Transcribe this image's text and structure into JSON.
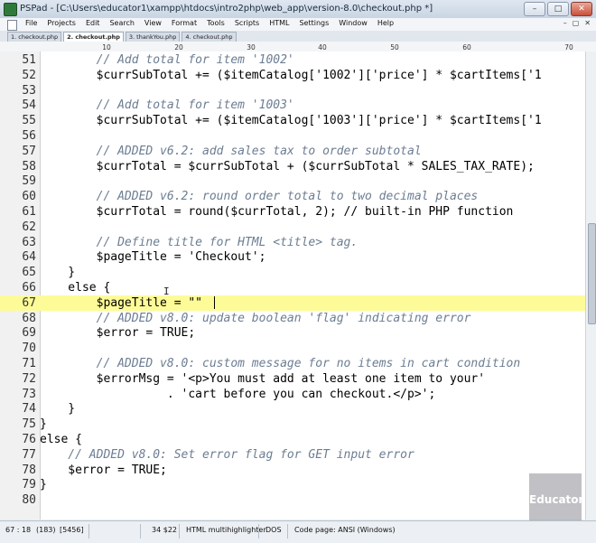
{
  "window": {
    "title": "PSPad - [C:\\Users\\educator1\\xampp\\htdocs\\intro2php\\web_app\\version-8.0\\checkout.php *]",
    "controls": {
      "minimize": "–",
      "maximize": "□",
      "close": "✕"
    }
  },
  "menu": {
    "items": [
      "File",
      "Projects",
      "Edit",
      "Search",
      "View",
      "Format",
      "Tools",
      "Scripts",
      "HTML",
      "Settings",
      "Window",
      "Help"
    ],
    "right_controls": [
      "–",
      "▢",
      "✕"
    ]
  },
  "tabs": [
    {
      "label": "1. checkout.php",
      "active": false
    },
    {
      "label": "2. checkout.php",
      "active": true
    },
    {
      "label": "3. thankYou.php",
      "active": false
    },
    {
      "label": "4. checkout.php",
      "active": false
    }
  ],
  "ruler": {
    "ticks": [
      "10",
      "20",
      "30",
      "40",
      "50",
      "60",
      "70"
    ]
  },
  "editor": {
    "highlighted_line": 67,
    "lines": [
      {
        "num": "51",
        "text": "        // Add total for item '1002'",
        "comment": true
      },
      {
        "num": "52",
        "text": "        $currSubTotal += ($itemCatalog['1002']['price'] * $cartItems['1",
        "comment": false
      },
      {
        "num": "53",
        "text": "",
        "comment": false
      },
      {
        "num": "54",
        "text": "        // Add total for item '1003'",
        "comment": true
      },
      {
        "num": "55",
        "text": "        $currSubTotal += ($itemCatalog['1003']['price'] * $cartItems['1",
        "comment": false
      },
      {
        "num": "56",
        "text": "",
        "comment": false
      },
      {
        "num": "57",
        "text": "        // ADDED v6.2: add sales tax to order subtotal",
        "comment": true
      },
      {
        "num": "58",
        "text": "        $currTotal = $currSubTotal + ($currSubTotal * SALES_TAX_RATE);",
        "comment": false
      },
      {
        "num": "59",
        "text": "",
        "comment": false
      },
      {
        "num": "60",
        "text": "        // ADDED v6.2: round order total to two decimal places",
        "comment": true
      },
      {
        "num": "61",
        "text": "        $currTotal = round($currTotal, 2); // built-in PHP function",
        "comment": false
      },
      {
        "num": "62",
        "text": "",
        "comment": false
      },
      {
        "num": "63",
        "text": "        // Define title for HTML <title> tag.",
        "comment": true
      },
      {
        "num": "64",
        "text": "        $pageTitle = 'Checkout';",
        "comment": false
      },
      {
        "num": "65",
        "text": "    }",
        "comment": false
      },
      {
        "num": "66",
        "text": "    else {",
        "comment": false
      },
      {
        "num": "67",
        "text": "        $pageTitle = \"\"",
        "comment": false
      },
      {
        "num": "68",
        "text": "        // ADDED v8.0: update boolean 'flag' indicating error",
        "comment": true
      },
      {
        "num": "69",
        "text": "        $error = TRUE;",
        "comment": false
      },
      {
        "num": "70",
        "text": "",
        "comment": false
      },
      {
        "num": "71",
        "text": "        // ADDED v8.0: custom message for no items in cart condition",
        "comment": true
      },
      {
        "num": "72",
        "text": "        $errorMsg = '<p>You must add at least one item to your'",
        "comment": false
      },
      {
        "num": "73",
        "text": "                  . 'cart before you can checkout.</p>';",
        "comment": false
      },
      {
        "num": "74",
        "text": "    }",
        "comment": false
      },
      {
        "num": "75",
        "text": "}",
        "comment": false
      },
      {
        "num": "76",
        "text": "else {",
        "comment": false
      },
      {
        "num": "77",
        "text": "    // ADDED v8.0: Set error flag for GET input error",
        "comment": true
      },
      {
        "num": "78",
        "text": "    $error = TRUE;",
        "comment": false
      },
      {
        "num": "79",
        "text": "}",
        "comment": false
      },
      {
        "num": "80",
        "text": "",
        "comment": false
      }
    ]
  },
  "statusbar": {
    "position": "67 : 18",
    "lines": "(183)",
    "size": "[5456]",
    "code": "34 $22",
    "highlighter": "HTML multihighlighter",
    "eol": "DOS",
    "codepage": "Code page: ANSI (Windows)"
  },
  "watermark": {
    "text": "Educator"
  },
  "colors": {
    "highlight": "#fdfb98",
    "comment": "#6c7d92"
  }
}
